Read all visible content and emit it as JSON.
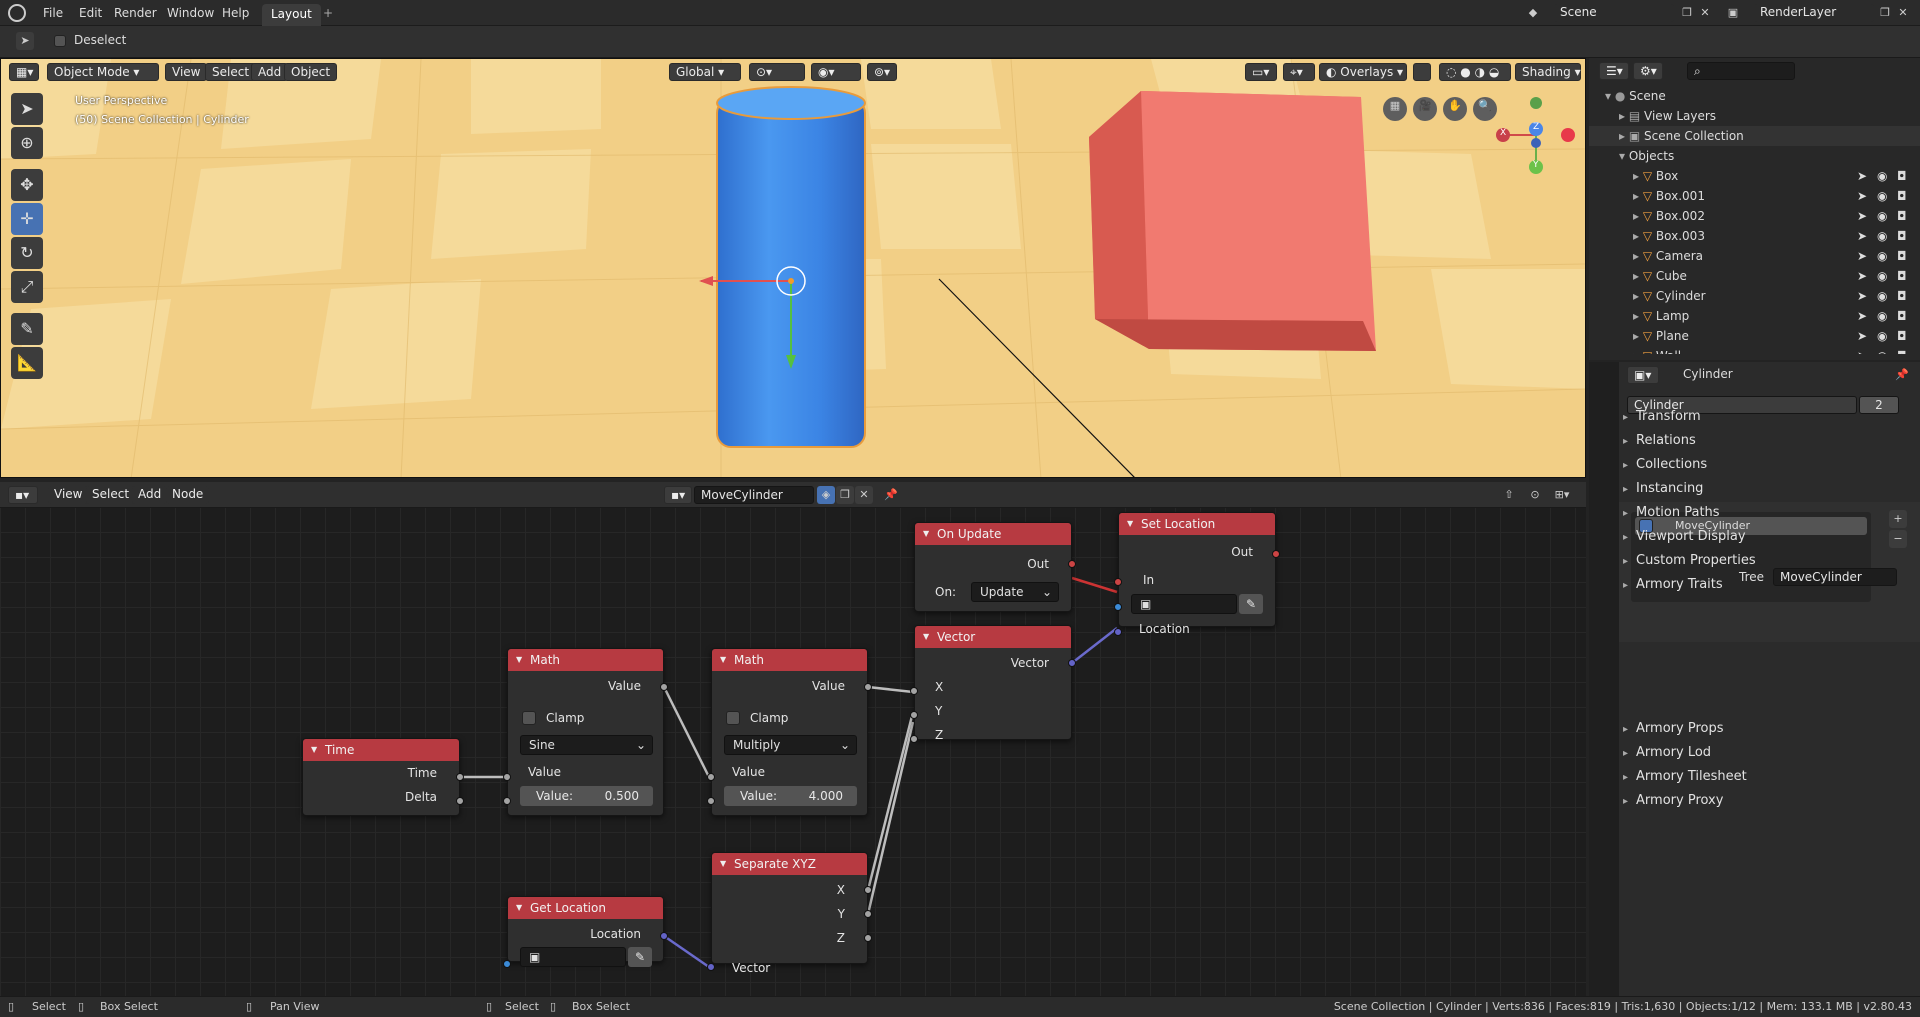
{
  "menu": {
    "file": "File",
    "edit": "Edit",
    "render": "Render",
    "window": "Window",
    "help": "Help",
    "tab": "Layout",
    "add_tab": "+"
  },
  "scene": {
    "label": "Scene",
    "layer": "RenderLayer"
  },
  "toolbar": {
    "deselect": "Deselect"
  },
  "viewport": {
    "mode": "Object Mode",
    "view": "View",
    "select": "Select",
    "add": "Add",
    "object": "Object",
    "orientation": "Global",
    "overlays": "Overlays",
    "shading": "Shading",
    "perspective": "User Perspective",
    "collection_info": "(50) Scene Collection | Cylinder",
    "axis_x": "X",
    "axis_y": "Y",
    "axis_z": "Z"
  },
  "node_editor": {
    "view": "View",
    "select": "Select",
    "add": "Add",
    "node": "Node",
    "tree_name": "MoveCylinder"
  },
  "nodes": {
    "time": {
      "title": "Time",
      "time": "Time",
      "delta": "Delta"
    },
    "math1": {
      "title": "Math",
      "value_out": "Value",
      "clamp": "Clamp",
      "op": "Sine",
      "value_in": "Value",
      "field_label": "Value:",
      "field_value": "0.500"
    },
    "math2": {
      "title": "Math",
      "value_out": "Value",
      "clamp": "Clamp",
      "op": "Multiply",
      "value_in": "Value",
      "field_label": "Value:",
      "field_value": "4.000"
    },
    "on_update": {
      "title": "On Update",
      "out": "Out",
      "on_label": "On:",
      "on_value": "Update"
    },
    "vector": {
      "title": "Vector",
      "vector": "Vector",
      "x": "X",
      "y": "Y",
      "z": "Z"
    },
    "set_location": {
      "title": "Set Location",
      "out": "Out",
      "in": "In",
      "location": "Location"
    },
    "separate": {
      "title": "Separate XYZ",
      "x": "X",
      "y": "Y",
      "z": "Z",
      "vector": "Vector"
    },
    "get_location": {
      "title": "Get Location",
      "location": "Location"
    }
  },
  "outliner": {
    "scene": "Scene",
    "view_layers": "View Layers",
    "scene_collection": "Scene Collection",
    "objects": "Objects",
    "items": [
      "Box",
      "Box.001",
      "Box.002",
      "Box.003",
      "Camera",
      "Cube",
      "Cylinder",
      "Lamp",
      "Plane",
      "Wall"
    ]
  },
  "properties": {
    "object_name": "Cylinder",
    "data_name": "Cylinder",
    "users": "2",
    "panels": [
      "Transform",
      "Relations",
      "Collections",
      "Instancing",
      "Motion Paths",
      "Viewport Display",
      "Custom Properties",
      "Armory Traits"
    ],
    "trait": "MoveCylinder",
    "tree_label": "Tree",
    "tree_value": "MoveCylinder",
    "panels2": [
      "Armory Props",
      "Armory Lod",
      "Armory Tilesheet",
      "Armory Proxy"
    ]
  },
  "status": {
    "select": "Select",
    "box_select": "Box Select",
    "pan_view": "Pan View",
    "select2": "Select",
    "box_select2": "Box Select",
    "info": "Scene Collection | Cylinder | Verts:836 | Faces:819 | Tris:1,630 | Objects:1/12 | Mem: 133.1 MB | v2.80.43"
  }
}
